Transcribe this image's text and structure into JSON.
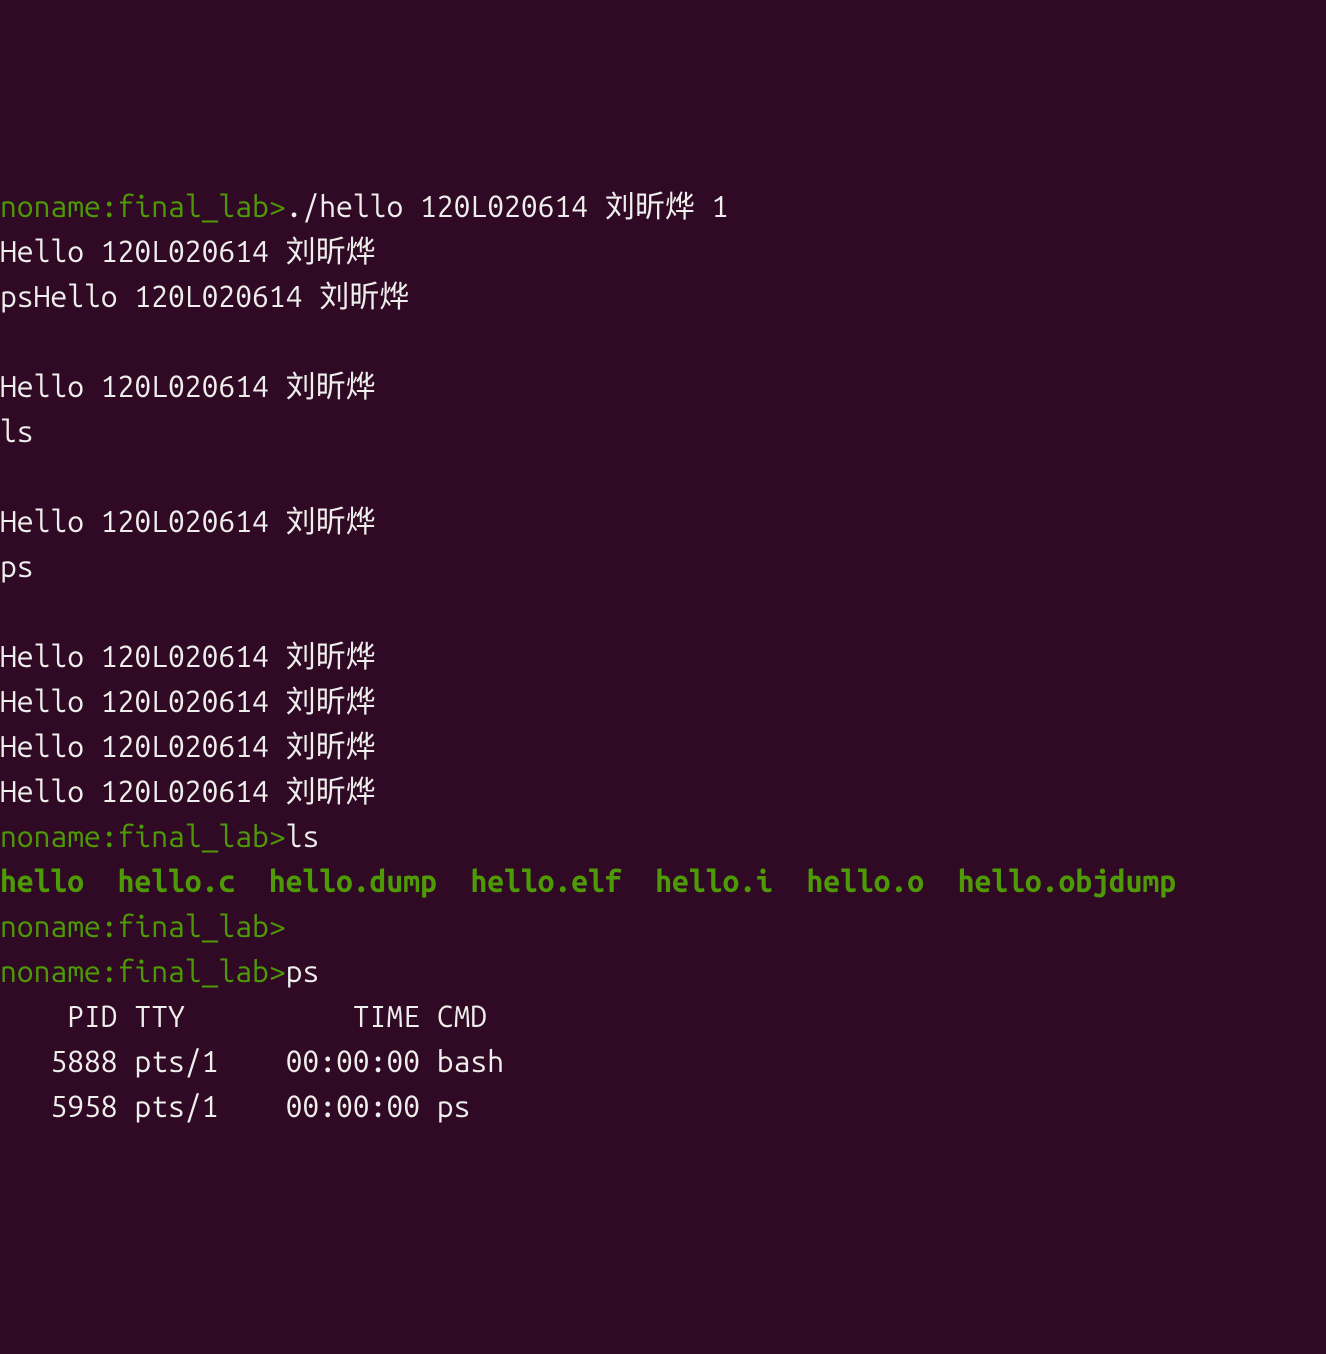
{
  "prompt": {
    "user_host": "noname",
    "dir": "final_lab",
    "sep": ":",
    "end": ">"
  },
  "cmd1": "./hello 120L020614 刘昕烨 1",
  "out": {
    "l1": "Hello 120L020614 刘昕烨",
    "l2": "psHello 120L020614 刘昕烨",
    "l3": "",
    "l4": "Hello 120L020614 刘昕烨",
    "l5": "ls",
    "l6": "",
    "l7": "Hello 120L020614 刘昕烨",
    "l8": "ps",
    "l9": "",
    "l10": "Hello 120L020614 刘昕烨",
    "l11": "Hello 120L020614 刘昕烨",
    "l12": "Hello 120L020614 刘昕烨",
    "l13": "Hello 120L020614 刘昕烨"
  },
  "cmd2": "ls",
  "ls_items": {
    "i0": "hello",
    "i1": "hello.c",
    "i2": "hello.dump",
    "i3": "hello.elf",
    "i4": "hello.i",
    "i5": "hello.o",
    "i6": "hello.objdump"
  },
  "cmd3": "",
  "cmd4": "ps",
  "ps": {
    "header": "    PID TTY          TIME CMD",
    "r1": "   5888 pts/1    00:00:00 bash",
    "r2": "   5958 pts/1    00:00:00 ps"
  }
}
